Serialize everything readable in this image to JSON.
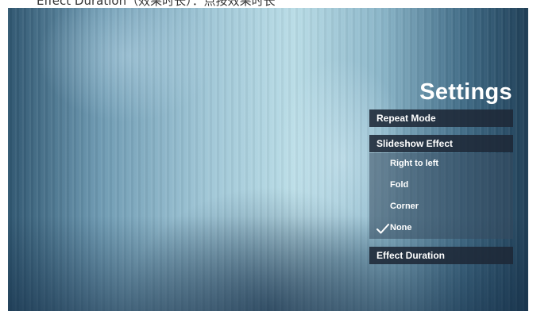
{
  "caption": "Effect Duration（效果时长）：点按效果时长",
  "settings": {
    "title": "Settings",
    "repeat_mode": "Repeat Mode",
    "slideshow_effect": "Slideshow Effect",
    "effect_duration": "Effect Duration",
    "options": [
      {
        "label": "Right to left",
        "selected": false
      },
      {
        "label": "Fold",
        "selected": false
      },
      {
        "label": "Corner",
        "selected": false
      },
      {
        "label": "None",
        "selected": true
      }
    ]
  },
  "colors": {
    "panel": "#1e2837",
    "text": "#ffffff"
  },
  "icons": {
    "check": "checkmark-icon"
  }
}
